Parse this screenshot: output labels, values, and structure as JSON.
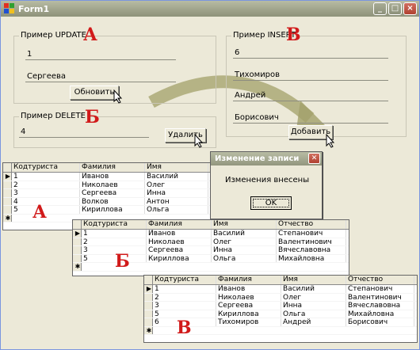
{
  "window": {
    "title": "Form1"
  },
  "colors": {
    "accent_letter": "#d11a1a",
    "titlebar": "#9ea28a",
    "arrow": "#a3a06a"
  },
  "update_group": {
    "label": "Пример UPDATE",
    "letter": "А",
    "field1": "1",
    "field2": "Сергеева",
    "button": "Обновить"
  },
  "insert_group": {
    "label": "Пример INSERT",
    "letter": "В",
    "field1": "6",
    "field2": "Тихомиров",
    "field3": "Андрей",
    "field4": "Борисович",
    "button": "Добавить"
  },
  "delete_group": {
    "label": "Пример DELETE",
    "letter": "Б",
    "field1": "4",
    "button": "Удалить"
  },
  "grid_a": {
    "letter": "А",
    "columns": [
      "Кодтуриста",
      "Фамилия",
      "Имя"
    ],
    "rows": [
      [
        "1",
        "Иванов",
        "Василий"
      ],
      [
        "2",
        "Николаев",
        "Олег"
      ],
      [
        "3",
        "Сергеева",
        "Инна"
      ],
      [
        "4",
        "Волков",
        "Антон"
      ],
      [
        "5",
        "Кириллова",
        "Ольга"
      ]
    ]
  },
  "grid_b": {
    "letter": "Б",
    "columns": [
      "Кодтуриста",
      "Фамилия",
      "Имя",
      "Отчество"
    ],
    "rows": [
      [
        "1",
        "Иванов",
        "Василий",
        "Степанович"
      ],
      [
        "2",
        "Николаев",
        "Олег",
        "Валентинович"
      ],
      [
        "3",
        "Сергеева",
        "Инна",
        "Вячеславовна"
      ],
      [
        "5",
        "Кириллова",
        "Ольга",
        "Михайловна"
      ]
    ]
  },
  "grid_c": {
    "letter": "В",
    "columns": [
      "Кодтуриста",
      "Фамилия",
      "Имя",
      "Отчество"
    ],
    "rows": [
      [
        "1",
        "Иванов",
        "Василий",
        "Степанович"
      ],
      [
        "2",
        "Николаев",
        "Олег",
        "Валентинович"
      ],
      [
        "3",
        "Сергеева",
        "Инна",
        "Вячеславовна"
      ],
      [
        "5",
        "Кириллова",
        "Ольга",
        "Михайловна"
      ],
      [
        "6",
        "Тихомиров",
        "Андрей",
        "Борисович"
      ]
    ]
  },
  "dialog": {
    "title": "Изменение записи",
    "message": "Изменения внесены",
    "ok": "OK"
  }
}
